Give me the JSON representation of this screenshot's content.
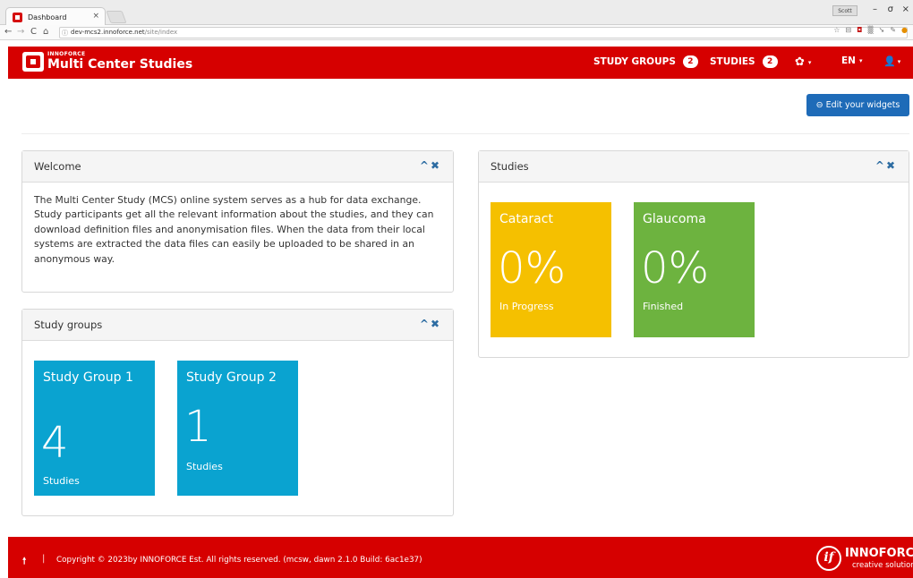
{
  "browser": {
    "tab_title": "Dashboard",
    "tab_close": "×",
    "user_chip": "Scott",
    "url_host": "dev-mcs2.innoforce.net",
    "url_path": "/site/index",
    "back_icon": "←",
    "forward_icon": "→",
    "reload_icon": "C",
    "home_icon": "⌂",
    "min_btn": "–",
    "max_btn": "σ",
    "close_btn": "×",
    "ext_icons": [
      "☆",
      "⊟",
      "◘",
      "▒",
      "➘",
      "✎",
      "●"
    ]
  },
  "navbar": {
    "brand_small": "INNOFORCE",
    "brand_name": "Multi Center Studies",
    "study_groups_label": "STUDY GROUPS",
    "study_groups_count": "2",
    "studies_label": "STUDIES",
    "studies_count": "2",
    "settings_icon": "✿",
    "language": "EN",
    "user_icon": "👤",
    "caret": "▾"
  },
  "toolbar": {
    "edit_widgets_label": "⊖ Edit your widgets"
  },
  "panels": {
    "welcome": {
      "title": "Welcome",
      "tools": "^✖",
      "text": "The Multi Center Study (MCS) online system serves as a hub for data exchange. Study participants get all the relevant information about the studies, and they can download definition files and anonymisation files. When the data from their local systems are extracted the data files can easily be uploaded to be shared in an anonymous way."
    },
    "study_groups": {
      "title": "Study groups",
      "tools": "^✖",
      "tiles": [
        {
          "title": "Study Group 1",
          "value": "4",
          "label": "Studies",
          "color": "#0aa3d0"
        },
        {
          "title": "Study Group 2",
          "value": "1",
          "label": "Studies",
          "color": "#0aa3d0"
        }
      ]
    },
    "studies": {
      "title": "Studies",
      "tools": "^✖",
      "tiles": [
        {
          "title": "Cataract",
          "value": "0%",
          "label": "In Progress",
          "color": "#f5c000"
        },
        {
          "title": "Glaucoma",
          "value": "0%",
          "label": "Finished",
          "color": "#6db33f"
        }
      ]
    }
  },
  "footer": {
    "arrow": "🠕",
    "separator": "|",
    "copyright": "Copyright © 2023by INNOFORCE Est. All rights reserved. (mcsw, dawn 2.1.0 Build: 6ac1e37)",
    "logo_mark": "if",
    "brand": "INNOFORCE",
    "tagline": "creative solutions"
  },
  "colors": {
    "brand_red": "#d60000",
    "button_blue": "#1e6bb8",
    "tile_blue": "#0aa3d0",
    "tile_yellow": "#f5c000",
    "tile_green": "#6db33f"
  }
}
